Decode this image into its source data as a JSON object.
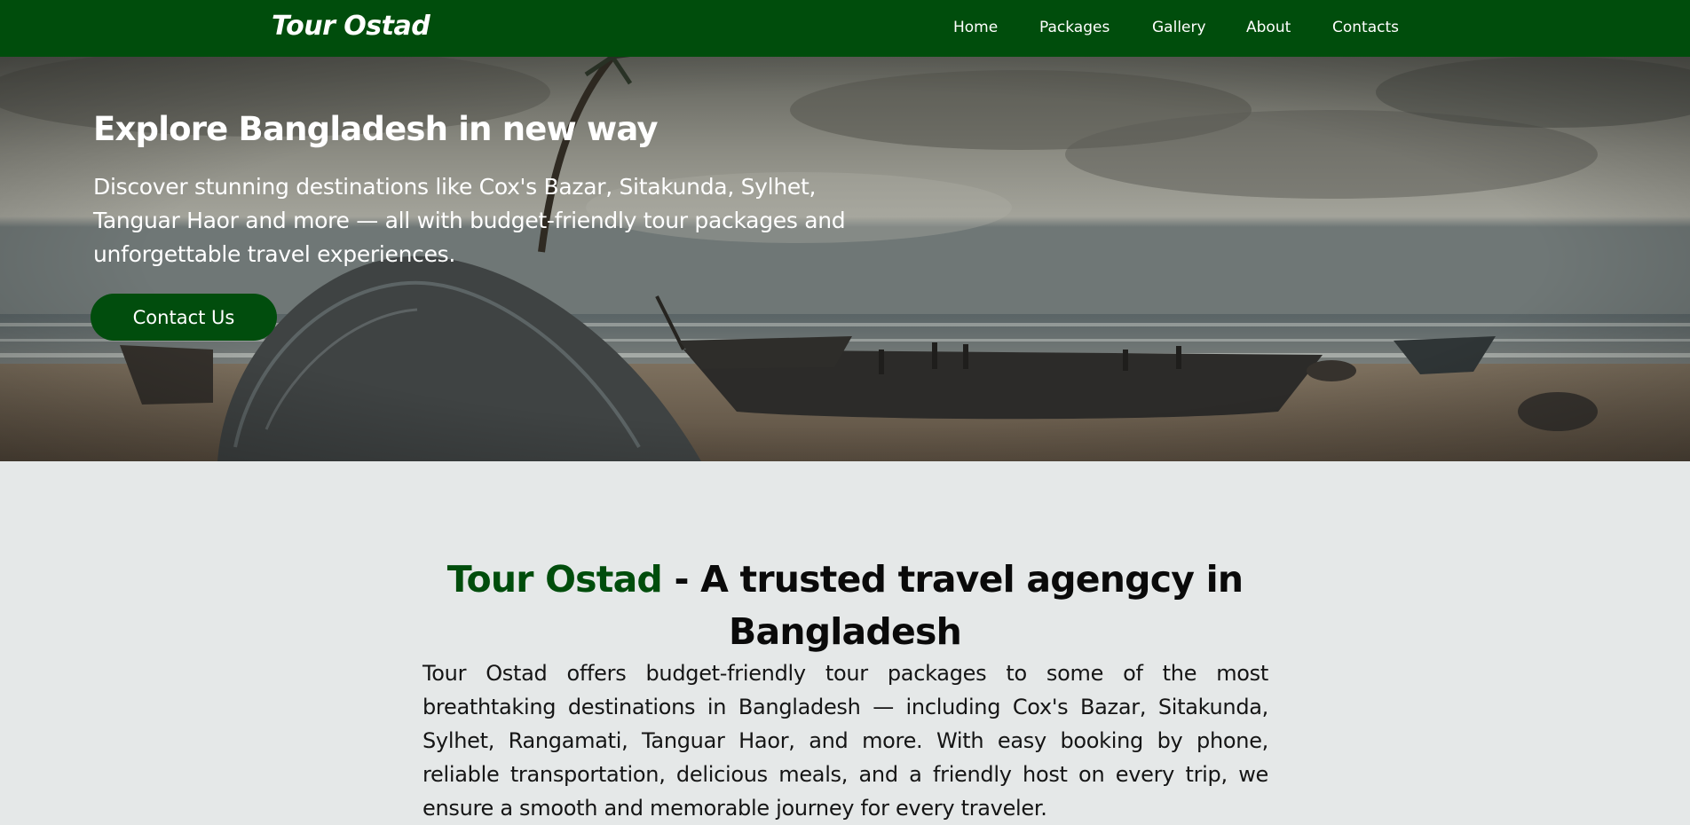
{
  "header": {
    "brand": "Tour Ostad",
    "nav": [
      "Home",
      "Packages",
      "Gallery",
      "About",
      "Contacts"
    ]
  },
  "hero": {
    "title": "Explore Bangladesh in new way",
    "text": "Discover stunning destinations like Cox's Bazar, Sitakunda, Sylhet, Tanguar Haor and more — all with budget-friendly tour packages and unforgettable travel experiences.",
    "button_label": "Contact Us"
  },
  "about": {
    "title_accent": "Tour Ostad",
    "title_rest": " - A trusted travel agengcy in Bangladesh",
    "text": "Tour Ostad offers budget-friendly tour packages to some of the most breathtaking destinations in Bangladesh — including Cox's Bazar, Sitakunda, Sylhet, Rangamati, Tanguar Haor, and more. With easy booking by phone, reliable transportation, delicious meals, and a friendly host on every trip, we ensure a smooth and memorable journey for every traveler."
  },
  "colors": {
    "brand_green": "#004d0c",
    "page_background": "#e5e8e8"
  }
}
